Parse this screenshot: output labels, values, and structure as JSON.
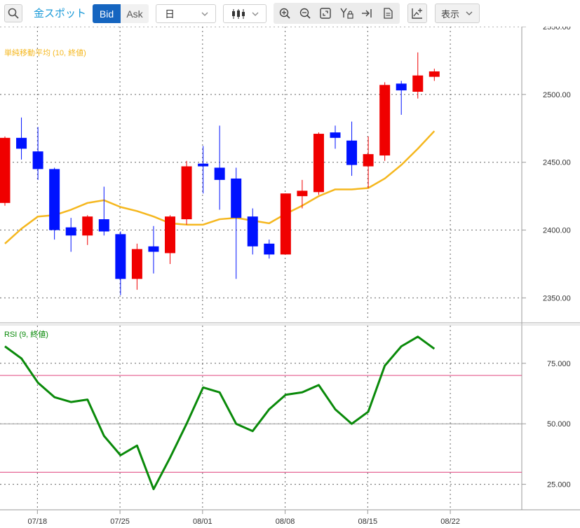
{
  "toolbar": {
    "symbol": "金スポット",
    "bid_label": "Bid",
    "ask_label": "Ask",
    "period": "日",
    "display_label": "表示",
    "icons": [
      "search-icon",
      "candlestick-icon",
      "zoom-in-icon",
      "zoom-out-icon",
      "fit-icon",
      "y-axis-lock-icon",
      "scroll-end-icon",
      "document-icon",
      "add-chart-icon",
      "chevron-down-icon"
    ]
  },
  "colors": {
    "up": "#f00000",
    "down": "#0012ff",
    "ma": "#f5b71e",
    "rsi": "#0a8a0a",
    "rsi_band": "#e0457e",
    "accent": "#1565c0"
  },
  "chart_data": [
    {
      "type": "candlestick",
      "title": "単純移動平均 (10, 終値)",
      "yticks": [
        "2350.00",
        "2400.00",
        "2450.00",
        "2500.00",
        "2550.00"
      ],
      "ylim": [
        2345,
        2550
      ],
      "xticks": [
        "07/18",
        "07/25",
        "08/01",
        "08/08",
        "08/15",
        "08/22"
      ],
      "grid": true,
      "candles": [
        {
          "o": 2420,
          "h": 2469,
          "l": 2418,
          "c": 2468
        },
        {
          "o": 2468,
          "h": 2483,
          "l": 2452,
          "c": 2460
        },
        {
          "o": 2458,
          "h": 2476,
          "l": 2437,
          "c": 2445
        },
        {
          "o": 2445,
          "h": 2446,
          "l": 2393,
          "c": 2400
        },
        {
          "o": 2402,
          "h": 2409,
          "l": 2384,
          "c": 2396
        },
        {
          "o": 2396,
          "h": 2411,
          "l": 2389,
          "c": 2410
        },
        {
          "o": 2408,
          "h": 2432,
          "l": 2396,
          "c": 2399
        },
        {
          "o": 2397,
          "h": 2399,
          "l": 2352,
          "c": 2364
        },
        {
          "o": 2364,
          "h": 2390,
          "l": 2356,
          "c": 2386
        },
        {
          "o": 2388,
          "h": 2403,
          "l": 2368,
          "c": 2384
        },
        {
          "o": 2383,
          "h": 2411,
          "l": 2375,
          "c": 2410
        },
        {
          "o": 2408,
          "h": 2451,
          "l": 2404,
          "c": 2447
        },
        {
          "o": 2449,
          "h": 2462,
          "l": 2427,
          "c": 2447
        },
        {
          "o": 2446,
          "h": 2477,
          "l": 2415,
          "c": 2437
        },
        {
          "o": 2438,
          "h": 2446,
          "l": 2364,
          "c": 2409
        },
        {
          "o": 2410,
          "h": 2416,
          "l": 2382,
          "c": 2388
        },
        {
          "o": 2390,
          "h": 2393,
          "l": 2379,
          "c": 2382
        },
        {
          "o": 2382,
          "h": 2427,
          "l": 2382,
          "c": 2427
        },
        {
          "o": 2425,
          "h": 2437,
          "l": 2416,
          "c": 2429
        },
        {
          "o": 2428,
          "h": 2472,
          "l": 2426,
          "c": 2471
        },
        {
          "o": 2472,
          "h": 2477,
          "l": 2460,
          "c": 2468
        },
        {
          "o": 2466,
          "h": 2480,
          "l": 2440,
          "c": 2448
        },
        {
          "o": 2447,
          "h": 2469,
          "l": 2431,
          "c": 2456
        },
        {
          "o": 2455,
          "h": 2509,
          "l": 2451,
          "c": 2507
        },
        {
          "o": 2508,
          "h": 2510,
          "l": 2485,
          "c": 2503
        },
        {
          "o": 2502,
          "h": 2531,
          "l": 2497,
          "c": 2514
        },
        {
          "o": 2513,
          "h": 2519,
          "l": 2510,
          "c": 2517
        }
      ],
      "ma": [
        2390,
        2401,
        2410,
        2411,
        2415,
        2420,
        2422,
        2417,
        2414,
        2410,
        2405,
        2404,
        2404,
        2408,
        2409,
        2407,
        2405,
        2412,
        2418,
        2425,
        2430,
        2430,
        2431,
        2438,
        2448,
        2460,
        2473
      ]
    },
    {
      "type": "line",
      "title": "RSI (9, 終値)",
      "yticks": [
        "25.000",
        "50.000",
        "75.000"
      ],
      "ylim": [
        18,
        97
      ],
      "bands": [
        30,
        70
      ],
      "xticks": [
        "07/18",
        "07/25",
        "08/01",
        "08/08",
        "08/15",
        "08/22"
      ],
      "values": [
        82,
        77,
        67,
        61,
        59,
        60,
        45,
        37,
        41,
        23,
        36,
        50,
        65,
        63,
        50,
        47,
        56,
        62,
        63,
        66,
        56,
        50,
        55,
        74,
        82,
        86,
        81
      ]
    }
  ]
}
